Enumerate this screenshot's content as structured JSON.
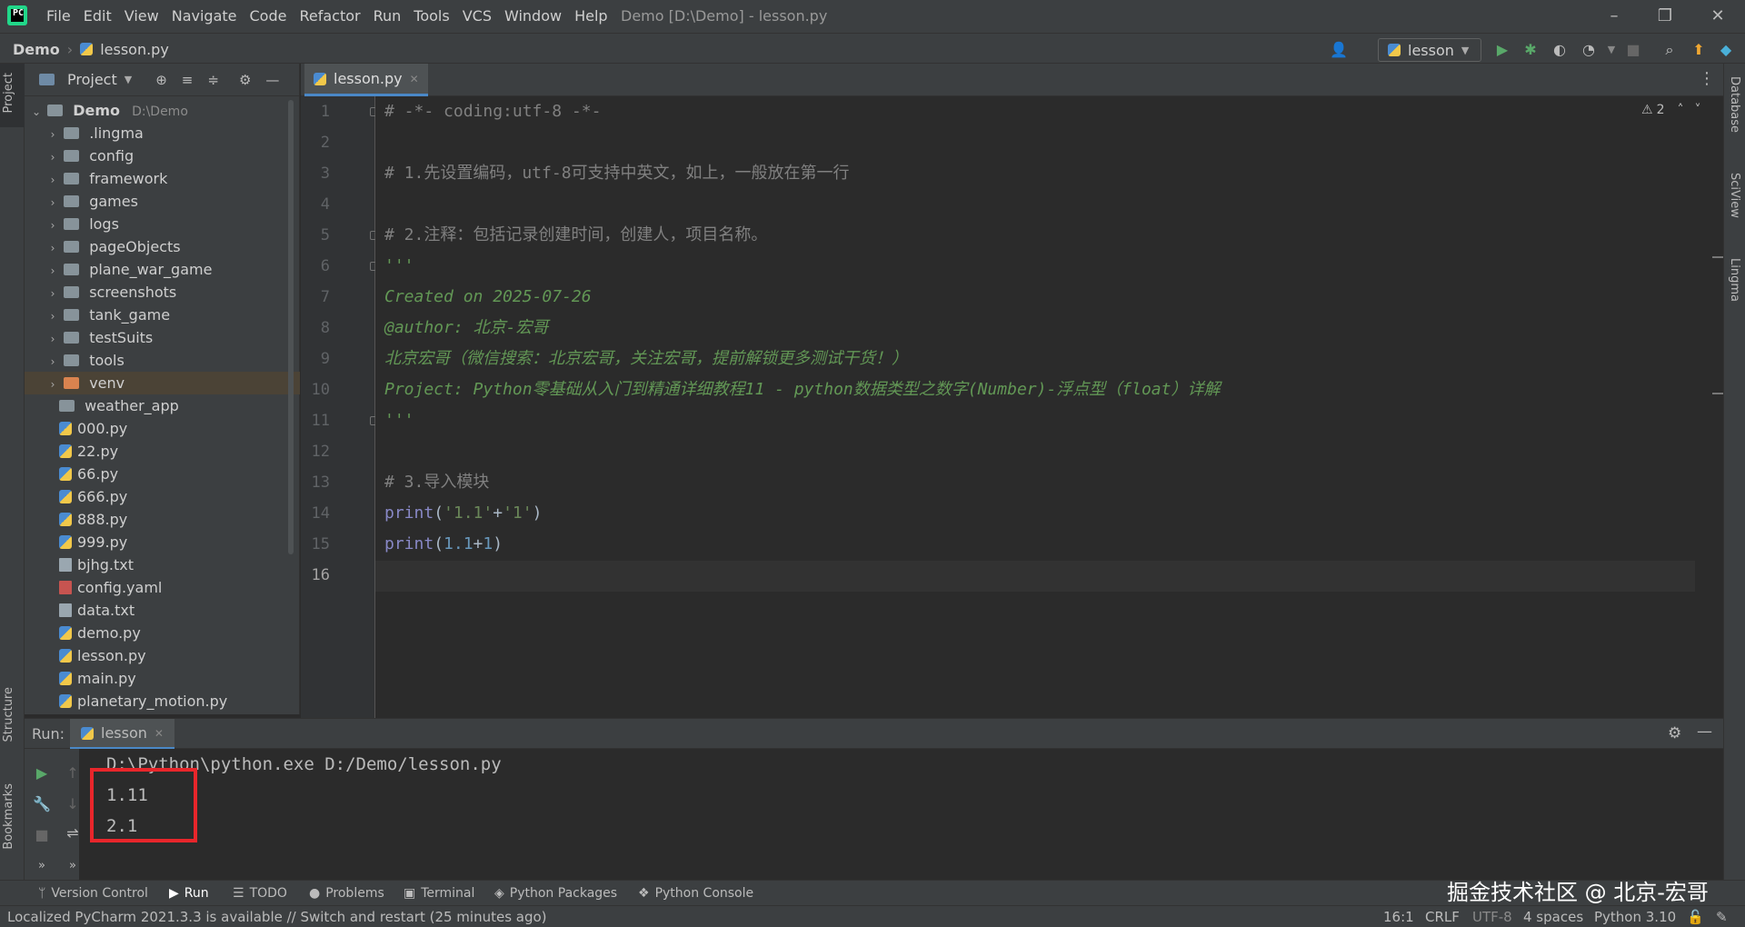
{
  "menu": {
    "items": [
      "File",
      "Edit",
      "View",
      "Navigate",
      "Code",
      "Refactor",
      "Run",
      "Tools",
      "VCS",
      "Window",
      "Help"
    ],
    "window_title": "Demo [D:\\Demo] - lesson.py"
  },
  "navbar": {
    "breadcrumb_project": "Demo",
    "breadcrumb_file": "lesson.py",
    "run_config": "lesson"
  },
  "left_strip": {
    "project_tab": "Project",
    "structure_tab": "Structure",
    "bookmarks_tab": "Bookmarks"
  },
  "right_strip": {
    "database_tab": "Database",
    "sciview_tab": "SciView",
    "lingma_tab": "Lingma"
  },
  "project_panel": {
    "title": "Project",
    "root_name": "Demo",
    "root_path": "D:\\Demo",
    "folders": [
      ".lingma",
      "config",
      "framework",
      "games",
      "logs",
      "pageObjects",
      "plane_war_game",
      "screenshots",
      "tank_game",
      "testSuits",
      "tools",
      "venv",
      "weather_app"
    ],
    "files": [
      "000.py",
      "22.py",
      "66.py",
      "666.py",
      "888.py",
      "999.py",
      "bjhg.txt",
      "config.yaml",
      "data.txt",
      "demo.py",
      "lesson.py",
      "main.py",
      "planetary_motion.py"
    ]
  },
  "editor": {
    "tab_label": "lesson.py",
    "warning_count": "2",
    "line_numbers": [
      "1",
      "2",
      "3",
      "4",
      "5",
      "6",
      "7",
      "8",
      "9",
      "10",
      "11",
      "12",
      "13",
      "14",
      "15",
      "16"
    ],
    "lines": {
      "l1": "# -*- coding:utf-8 -*-",
      "l3": "# 1.先设置编码，utf-8可支持中英文，如上，一般放在第一行",
      "l5": "# 2.注释：包括记录创建时间，创建人，项目名称。",
      "l6": "'''",
      "l7": "Created on 2025-07-26",
      "l8": "@author: 北京-宏哥",
      "l9": "北京宏哥（微信搜索：北京宏哥，关注宏哥，提前解锁更多测试干货！）",
      "l10": "Project: Python零基础从入门到精通详细教程11 - python数据类型之数字(Number)-浮点型（float）详解",
      "l11": "'''",
      "l13": "# 3.导入模块",
      "l14_fn": "print",
      "l14_open": "(",
      "l14_s1": "'1.1'",
      "l14_plus": "+",
      "l14_s2": "'1'",
      "l14_close": ")",
      "l15_fn": "print",
      "l15_open": "(",
      "l15_n1": "1.1",
      "l15_plus": "+",
      "l15_n2": "1",
      "l15_close": ")"
    }
  },
  "run_panel": {
    "label": "Run:",
    "tab": "lesson",
    "console": [
      "D:\\Python\\python.exe D:/Demo/lesson.py",
      "1.11",
      "2.1"
    ]
  },
  "tool_windows": [
    "Version Control",
    "Run",
    "TODO",
    "Problems",
    "Terminal",
    "Python Packages",
    "Python Console"
  ],
  "watermark": "掘金技术社区 @ 北京-宏哥",
  "status": {
    "message": "Localized PyCharm 2021.3.3 is available // Switch and restart (25 minutes ago)",
    "position": "16:1",
    "line_sep": "CRLF",
    "encoding": "UTF-8",
    "indent": "4 spaces",
    "interpreter": "Python 3.10"
  },
  "colors": {
    "accent": "#4a88c7",
    "highlight_box": "#e8262b",
    "docstring": "#629755",
    "comment": "#808080"
  }
}
